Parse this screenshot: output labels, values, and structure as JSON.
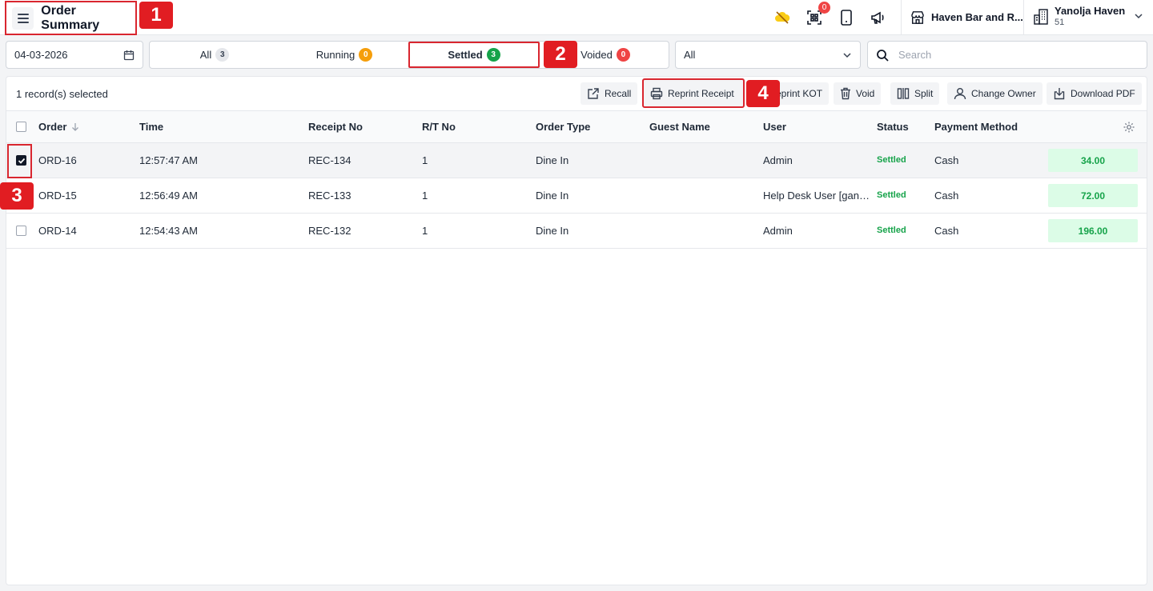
{
  "header": {
    "title": "Order Summary",
    "notification_count": "0",
    "store_name": "Haven Bar and R...",
    "account_name": "Yanolja Haven",
    "account_id": "51"
  },
  "markers": [
    "1",
    "2",
    "3",
    "4"
  ],
  "filters": {
    "date": "04-03-2026",
    "tabs": [
      {
        "label": "All",
        "count": "3",
        "color": "#e5e7eb"
      },
      {
        "label": "Running",
        "count": "0",
        "color": "#f59e0b"
      },
      {
        "label": "Settled",
        "count": "3",
        "color": "#16a34a"
      },
      {
        "label": "Voided",
        "count": "0",
        "color": "#ef4444"
      }
    ],
    "status_select": "All",
    "search_placeholder": "Search"
  },
  "toolbar": {
    "selected_text": "1 record(s) selected",
    "recall": "Recall",
    "reprint_receipt": "Reprint Receipt",
    "reprint_kot": "eprint KOT",
    "void": "Void",
    "split": "Split",
    "change_owner": "Change Owner",
    "download_pdf": "Download PDF"
  },
  "table": {
    "columns": [
      "Order",
      "Time",
      "Receipt No",
      "R/T No",
      "Order Type",
      "Guest Name",
      "User",
      "Status",
      "Payment Method"
    ],
    "rows": [
      {
        "order": "ORD-16",
        "time": "12:57:47 AM",
        "receipt": "REC-134",
        "rt": "1",
        "type": "Dine In",
        "guest": "",
        "user": "Admin",
        "status": "Settled",
        "payment": "Cash",
        "amount": "34.00",
        "checked": true
      },
      {
        "order": "ORD-15",
        "time": "12:56:49 AM",
        "receipt": "REC-133",
        "rt": "1",
        "type": "Dine In",
        "guest": "",
        "user": "Help Desk User [gan…",
        "status": "Settled",
        "payment": "Cash",
        "amount": "72.00",
        "checked": false
      },
      {
        "order": "ORD-14",
        "time": "12:54:43 AM",
        "receipt": "REC-132",
        "rt": "1",
        "type": "Dine In",
        "guest": "",
        "user": "Admin",
        "status": "Settled",
        "payment": "Cash",
        "amount": "196.00",
        "checked": false
      }
    ]
  }
}
